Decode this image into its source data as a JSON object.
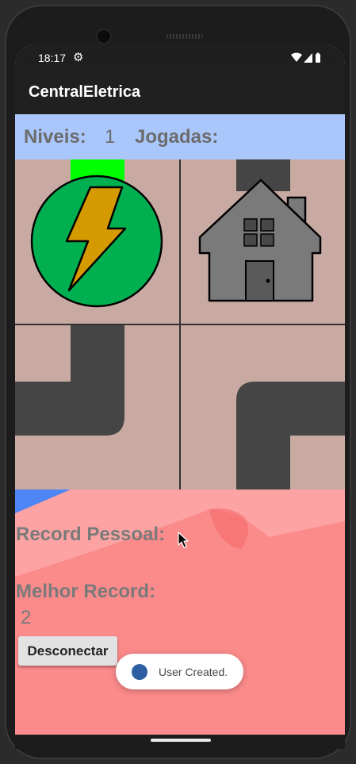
{
  "status_bar": {
    "time": "18:17",
    "gear_icon": "gear-icon",
    "wifi_icon": "wifi-icon",
    "signal_icon": "signal-icon",
    "battery_icon": "battery-icon"
  },
  "app_bar": {
    "title": "CentralEletrica"
  },
  "info_bar": {
    "niveis_label": "Niveis:",
    "niveis_value": "1",
    "jogadas_label": "Jogadas:",
    "jogadas_value": ""
  },
  "board": {
    "tiles": [
      {
        "icon": "power-plant-icon",
        "content": "lightning power plant with green wire stub on top"
      },
      {
        "icon": "house-icon",
        "content": "house with dark wire entering from top"
      },
      {
        "icon": "wire-corner-icon",
        "content": "dark wire bending from top to left"
      },
      {
        "icon": "wire-corner-icon",
        "content": "dark wire bending from bottom to right"
      }
    ]
  },
  "records": {
    "personal_label": "Record Pessoal:",
    "personal_value": "",
    "best_label": "Melhor Record:",
    "best_value": "2"
  },
  "buttons": {
    "disconnect_label": "Desconectar"
  },
  "toast": {
    "icon": "android-app-icon",
    "text": "User Created."
  },
  "colors": {
    "info_bar_bg": "#a9c7fb",
    "tile_bg": "#c9aaa3",
    "wire": "#454545",
    "powered_wire": "#00ff00",
    "plant_circle": "#00b050",
    "bolt": "#d49a00",
    "house": "#7a7a7a",
    "bottom_bg": "#fb8a8a"
  }
}
